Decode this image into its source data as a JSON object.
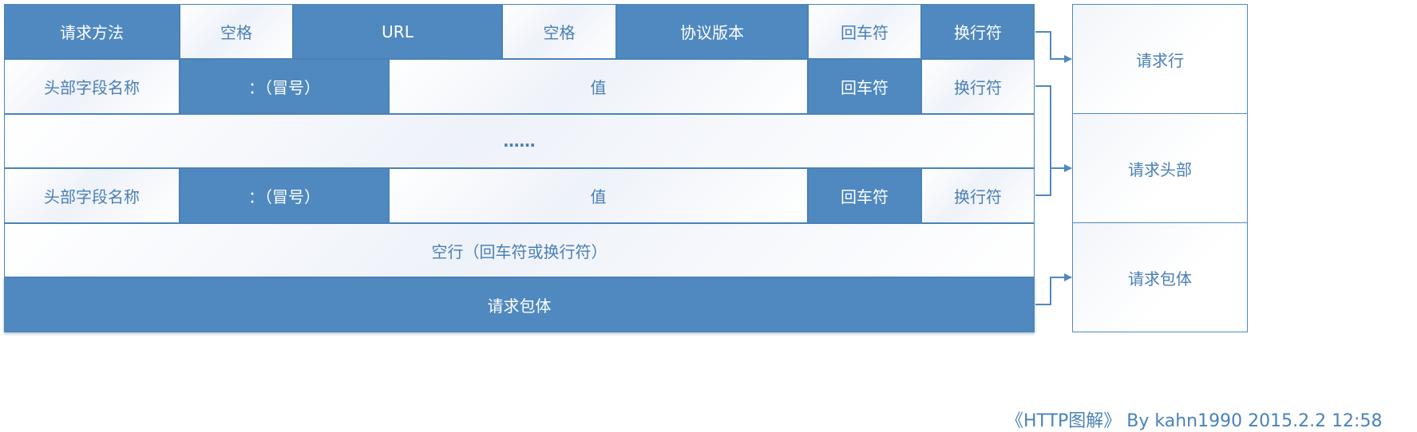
{
  "request_line": {
    "method": "请求方法",
    "space1": "空格",
    "url": "URL",
    "space2": "空格",
    "version": "协议版本",
    "cr": "回车符",
    "lf": "换行符"
  },
  "header1": {
    "name": "头部字段名称",
    "colon": "：（冒号）",
    "value": "值",
    "cr": "回车符",
    "lf": "换行符"
  },
  "ellipsis": "……",
  "header2": {
    "name": "头部字段名称",
    "colon": "：（冒号）",
    "value": "值",
    "cr": "回车符",
    "lf": "换行符"
  },
  "blank_line": "空行（回车符或换行符）",
  "body_row": "请求包体",
  "sections": {
    "request_line": "请求行",
    "headers": "请求头部",
    "body": "请求包体"
  },
  "footer": "《HTTP图解》 By kahn1990 2015.2.2 12:58",
  "colors": {
    "dark_fill": "#4f89bf",
    "light_text": "#4a7fb5",
    "border": "#4a82b8"
  }
}
